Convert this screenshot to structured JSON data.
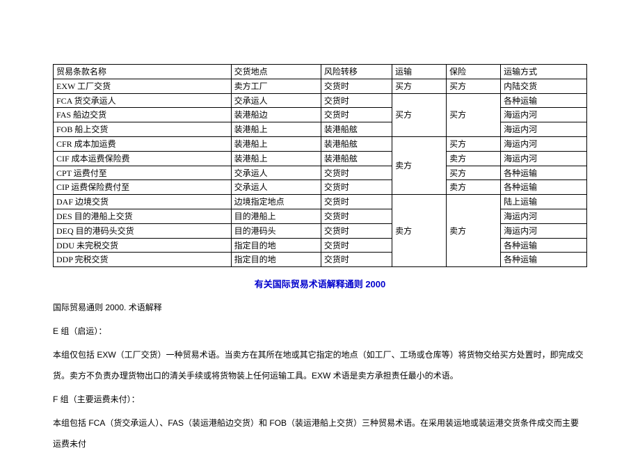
{
  "chart_data": {
    "type": "table",
    "headers": [
      "贸易条款名称",
      "交货地点",
      "风险转移",
      "运输",
      "保险",
      "运输方式"
    ],
    "groups": [
      {
        "rows": [
          {
            "name": "EXW 工厂交货",
            "place": "卖方工厂",
            "risk": "交货时",
            "transport": "买方",
            "insurance": "买方",
            "mode": "内陆交货"
          }
        ]
      },
      {
        "span_transport": "买方",
        "span_insurance": "买方",
        "rows": [
          {
            "name": "FCA 货交承运人",
            "place": "交承运人",
            "risk": "交货时",
            "mode": "各种运输"
          },
          {
            "name": "FAS 船边交货",
            "place": "装港船边",
            "risk": "交货时",
            "mode": "海运内河"
          },
          {
            "name": "FOB 船上交货",
            "place": "装港船上",
            "risk": "装港船舷",
            "mode": "海运内河"
          }
        ]
      },
      {
        "span_transport": "卖方",
        "rows": [
          {
            "name": "CFR 成本加运费",
            "place": "装港船上",
            "risk": "装港船舷",
            "insurance": "买方",
            "mode": "海运内河"
          },
          {
            "name": "CIF 成本运费保险费",
            "place": "装港船上",
            "risk": "装港船舷",
            "insurance": "卖方",
            "mode": "海运内河"
          },
          {
            "name": "CPT 运费付至",
            "place": "交承运人",
            "risk": "交货时",
            "insurance": "买方",
            "mode": "各种运输"
          },
          {
            "name": "CIP 运费保险费付至",
            "place": "交承运人",
            "risk": "交货时",
            "insurance": "卖方",
            "mode": "各种运输"
          }
        ]
      },
      {
        "span_transport": "卖方",
        "span_insurance": "卖方",
        "rows": [
          {
            "name": "DAF 边境交货",
            "place": "边境指定地点",
            "risk": "交货时",
            "mode": "陆上运输"
          },
          {
            "name": "DES 目的港船上交货",
            "place": "目的港船上",
            "risk": "交货时",
            "mode": "海运内河"
          },
          {
            "name": "DEQ 目的港码头交货",
            "place": "目的港码头",
            "risk": "交货时",
            "mode": "海运内河"
          },
          {
            "name": "DDU 未完税交货",
            "place": "指定目的地",
            "risk": "交货时",
            "mode": "各种运输"
          },
          {
            "name": "DDP 完税交货",
            "place": "指定目的地",
            "risk": "交货时",
            "mode": "各种运输"
          }
        ]
      }
    ]
  },
  "title": "有关国际贸易术语解释通则 2000",
  "p_intro": "国际贸易通则 2000. 术语解释",
  "p_e_head": "E 组（启运）：",
  "p_e_body": "本组仅包括 EXW（工厂交货）一种贸易术语。当卖方在其所在地或其它指定的地点（如工厂、工场或仓库等）将货物交给买方处置时，即完成交货。卖方不负责办理货物出口的清关手续或将货物装上任何运输工具。EXW 术语是卖方承担责任最小的术语。",
  "p_f_head": "F 组（主要运费未付）：",
  "p_f_body": "本组包括 FCA（货交承运人）、FAS（装运港船边交货）和 FOB（装运港船上交货）三种贸易术语。在采用装运地或装运港交货条件成交而主要运费未付"
}
